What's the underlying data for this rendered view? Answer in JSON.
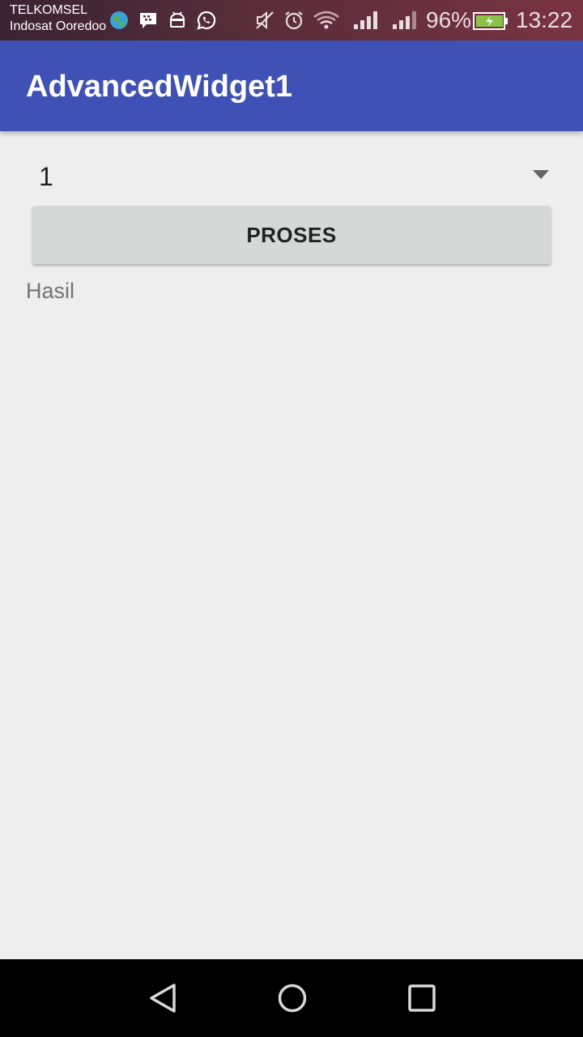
{
  "status_bar": {
    "carrier_1": "TELKOMSEL",
    "carrier_2": "Indosat Ooredoo",
    "battery_percent": "96%",
    "time": "13:22",
    "icons": [
      "globe-icon",
      "bbm-icon",
      "android-icon",
      "whatsapp-icon",
      "mute-icon",
      "alarm-icon",
      "wifi-icon",
      "signal-icon",
      "signal-icon",
      "battery-charging-icon"
    ]
  },
  "app_bar": {
    "title": "AdvancedWidget1",
    "color": "#3f51b5"
  },
  "main": {
    "spinner_value": "1",
    "button_label": "PROSES",
    "result_label": "Hasil"
  },
  "nav_bar": {
    "icons": [
      "back-icon",
      "home-icon",
      "recents-icon"
    ]
  }
}
